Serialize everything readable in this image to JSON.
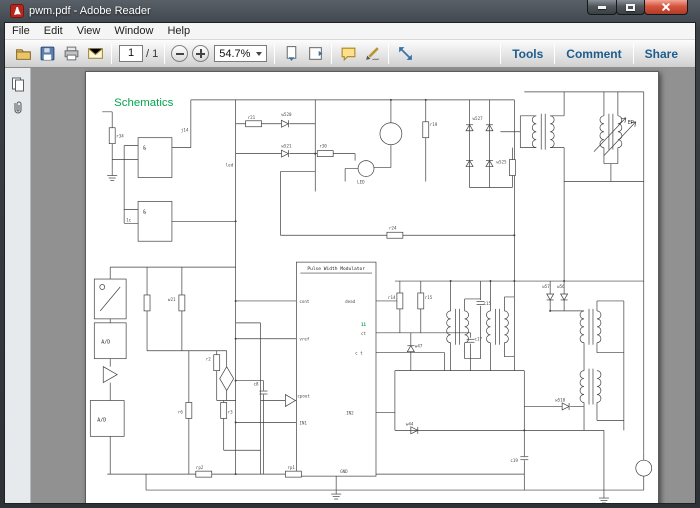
{
  "window": {
    "title": "pwm.pdf - Adobe Reader"
  },
  "menu": {
    "items": [
      "File",
      "Edit",
      "View",
      "Window",
      "Help"
    ]
  },
  "toolbar": {
    "page_value": "1",
    "page_total": "/ 1",
    "zoom_value": "54.7%",
    "tools_label": "Tools",
    "comment_label": "Comment",
    "share_label": "Share"
  },
  "doc": {
    "heading": "Schematics",
    "ic": {
      "title": "Pulse Width Modulator",
      "pins": {
        "cont": "cont",
        "dead": "dead",
        "vref": "vref",
        "ct": "ct",
        "ct2": "c t",
        "pin11": "11",
        "cpout": "cpout",
        "in1": "IN1",
        "in2": "IN2",
        "gnd": "GND"
      }
    },
    "labels": {
      "r34": "r34",
      "j14": "j14",
      "one_c": "1c",
      "led_small": "led",
      "w520": "w520",
      "w521": "w521",
      "r21": "r21",
      "r30": "r30",
      "r19": "r19",
      "led_big": "LED",
      "r24": "r24",
      "w527": "w527",
      "w525": "w525",
      "ep": "EP",
      "ad1": "A/D",
      "ad2": "A/D",
      "w21": "w21",
      "r2": "r2",
      "r3": "r3",
      "r6": "r6",
      "rp1": "rp1",
      "rp2": "rp2",
      "c8": "c8",
      "r14": "r14",
      "r15": "r15",
      "w47": "w47",
      "w44": "w44",
      "c15": "c15",
      "c17": "c17",
      "c19": "c19",
      "w57": "w57",
      "w56": "w56",
      "w510": "w510"
    }
  }
}
